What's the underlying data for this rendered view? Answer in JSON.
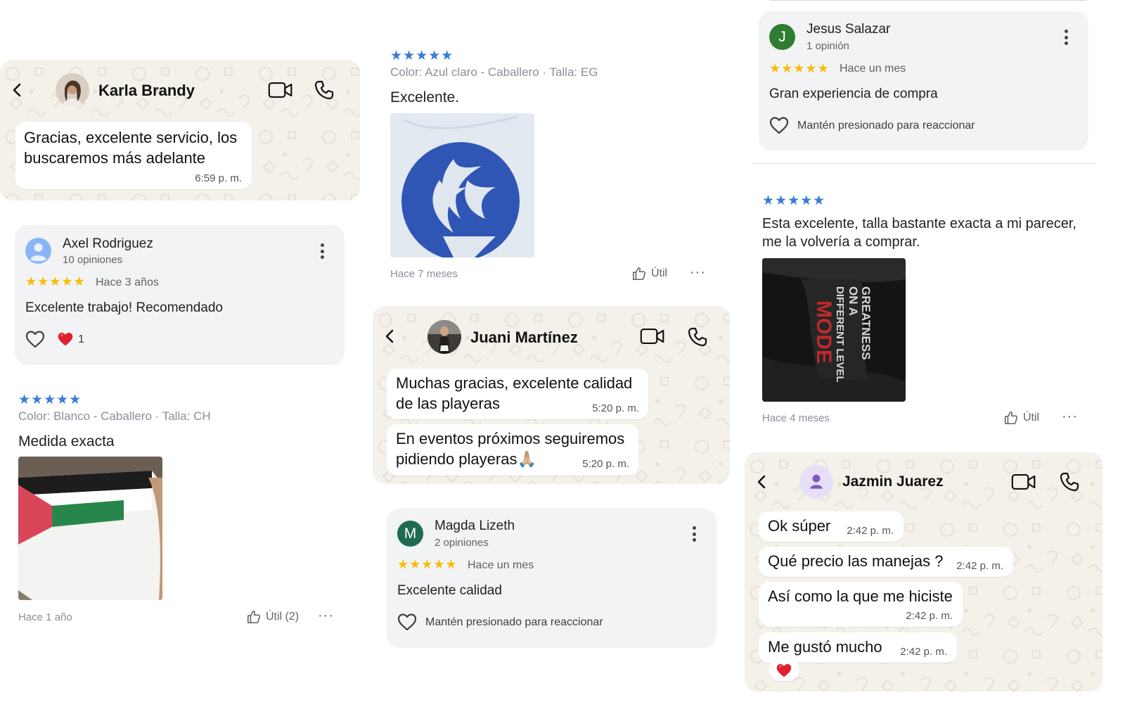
{
  "colors": {
    "whatsapp_bg": "#f4f1ea",
    "bubble": "#ffffff",
    "google_card": "#f1f3f4",
    "google_star": "#fbbc04",
    "shop_star": "#3a7bd5",
    "heart_red": "#e0202f"
  },
  "chat_karla": {
    "contact_name": "Karla Brandy",
    "icons": [
      "back-arrow-icon",
      "video-call-icon",
      "phone-icon"
    ],
    "messages": [
      {
        "text": "Gracias, excelente servicio, los buscaremos más adelante",
        "time": "6:59 p. m."
      }
    ]
  },
  "review_axel": {
    "author": "Axel Rodriguez",
    "review_count": "10 opiniones",
    "stars": "★★★★★",
    "when": "Hace 3 años",
    "text": "Excelente trabajo! Recomendado",
    "reaction_count": "1"
  },
  "shop_review_white": {
    "stars": "★★★★★",
    "variant": "Color: Blanco - Caballero · Talla: CH",
    "text": "Medida exacta",
    "date": "Hace 1 año",
    "helpful_label": "Útil (2)",
    "more": "···"
  },
  "shop_review_blue": {
    "stars": "★★★★★",
    "variant": "Color: Azul claro - Caballero · Talla: EG",
    "text": "Excelente.",
    "date": "Hace 7 meses",
    "helpful_label": "Útil",
    "more": "···"
  },
  "chat_juani": {
    "contact_name": "Juani Martínez",
    "messages": [
      {
        "text": "Muchas gracias, excelente calidad de las playeras",
        "time": "5:20 p. m."
      },
      {
        "text": "En eventos próximos seguiremos pidiendo playeras🙏🏼",
        "time": "5:20 p. m."
      }
    ]
  },
  "review_magda": {
    "avatar_letter": "M",
    "author": "Magda Lizeth",
    "review_count": "2 opiniones",
    "stars": "★★★★★",
    "when": "Hace un mes",
    "text": "Excelente calidad",
    "reaction_hint": "Mantén presionado para reaccionar"
  },
  "review_jesus": {
    "avatar_letter": "J",
    "author": "Jesus Salazar",
    "review_count": "1 opinión",
    "stars": "★★★★★",
    "when": "Hace un mes",
    "text": "Gran experiencia de compra",
    "reaction_hint": "Mantén presionado para reaccionar"
  },
  "shop_review_black": {
    "stars": "★★★★★",
    "text": "Esta excelente, talla bastante exacta a mi parecer, me la volvería a comprar.",
    "photo_print_lines": [
      "GREATNESS",
      "ON A",
      "DIFFERENT LEVEL",
      "MODE"
    ],
    "date": "Hace 4 meses",
    "helpful_label": "Útil",
    "more": "···"
  },
  "chat_jazmin": {
    "contact_name": "Jazmin Juarez",
    "messages": [
      {
        "text": "Ok súper",
        "time": "2:42 p. m."
      },
      {
        "text": "Qué precio las manejas ?",
        "time": "2:42 p. m."
      },
      {
        "text": "Así como la que me hiciste",
        "time": "2:42 p. m."
      },
      {
        "text": "Me gustó mucho",
        "time": "2:42 p. m."
      }
    ],
    "reaction": "❤️"
  }
}
